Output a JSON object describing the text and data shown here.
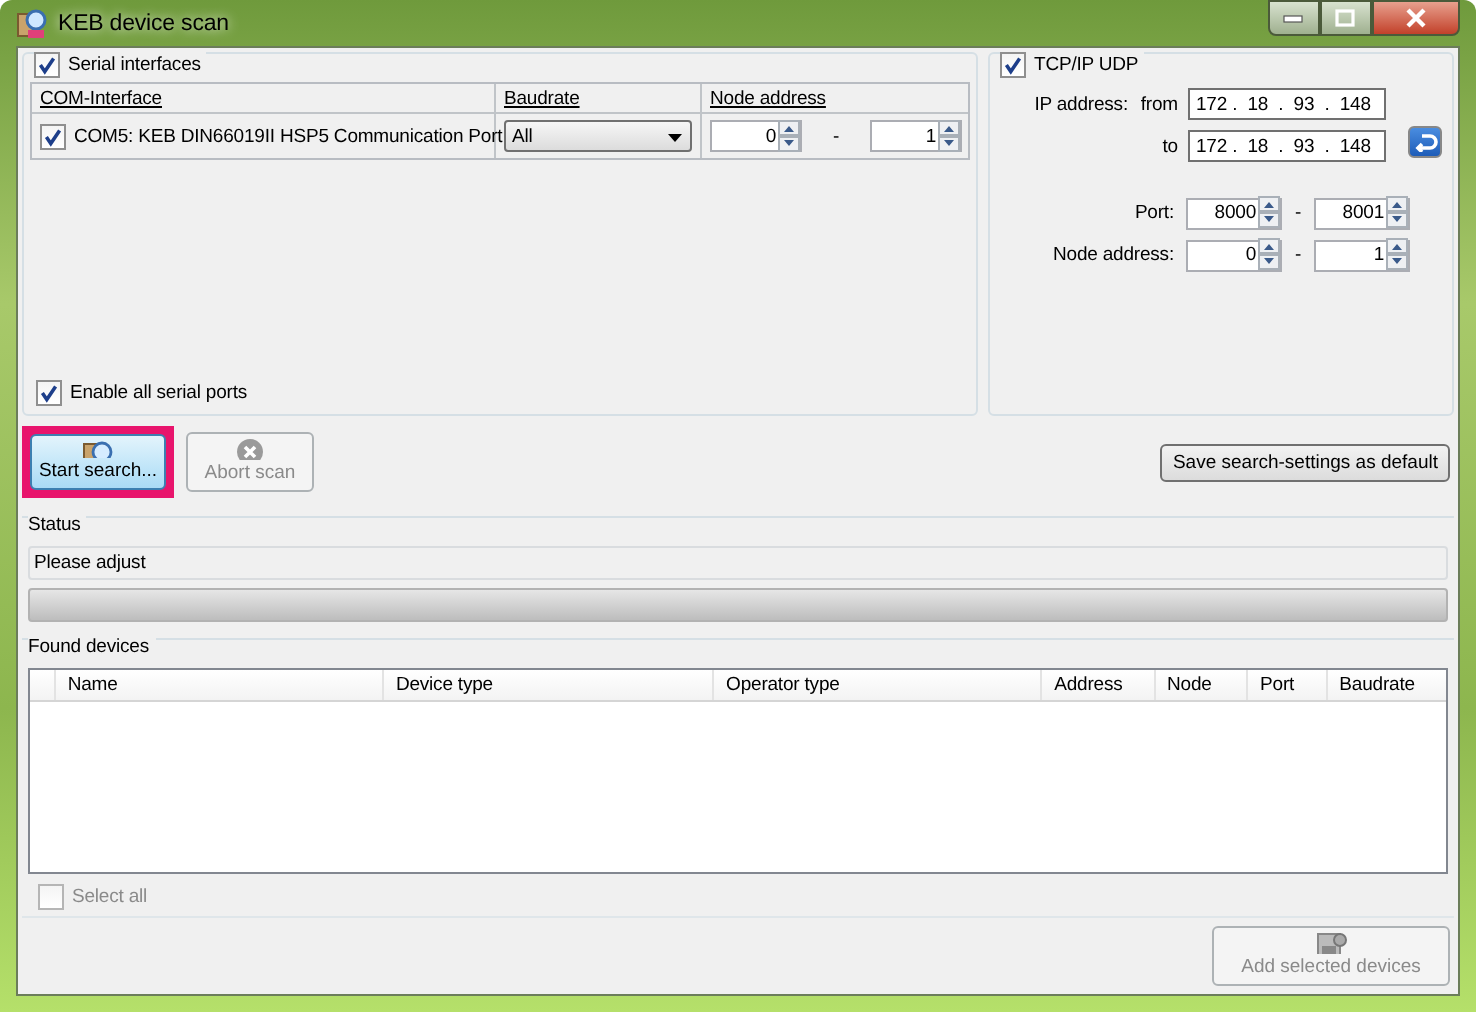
{
  "window": {
    "title": "KEB device scan"
  },
  "serial": {
    "label": "Serial interfaces",
    "checked": true,
    "columns": [
      "COM-Interface",
      "Baudrate",
      "Node address"
    ],
    "ports": [
      {
        "checked": true,
        "name": "COM5: KEB DIN66019II HSP5 Communication Port",
        "baudrate": "All",
        "node_from": "0",
        "separator": "-",
        "node_to": "1"
      }
    ],
    "enable_all": {
      "label": "Enable all serial ports",
      "checked": true
    }
  },
  "tcp": {
    "label": "TCP/IP UDP",
    "checked": true,
    "ip_label": "IP address:",
    "from_label": "from",
    "to_label": "to",
    "ip_from": "172 .  18  .  93  .  148",
    "ip_to": "172 .  18  .  93  .  148",
    "port_label": "Port:",
    "port_from": "8000",
    "port_sep": "-",
    "port_to": "8001",
    "node_label": "Node address:",
    "node_from": "0",
    "node_sep": "-",
    "node_to": "1"
  },
  "buttons": {
    "start": {
      "label": "Start search...",
      "highlighted": true,
      "disabled": false
    },
    "abort": {
      "label": "Abort scan",
      "disabled": true
    },
    "save": {
      "label": "Save search-settings as default"
    }
  },
  "status": {
    "title": "Status",
    "message": "Please adjust",
    "level": 0
  },
  "found": {
    "title": "Found devices",
    "columns": [
      "Name",
      "Device type",
      "Operator type",
      "Address",
      "Node",
      "Port",
      "Baudrate"
    ],
    "select_all": {
      "label": "Select all",
      "checked": false,
      "disabled": true
    }
  },
  "add_button": {
    "label": "Add selected devices",
    "disabled": true
  }
}
